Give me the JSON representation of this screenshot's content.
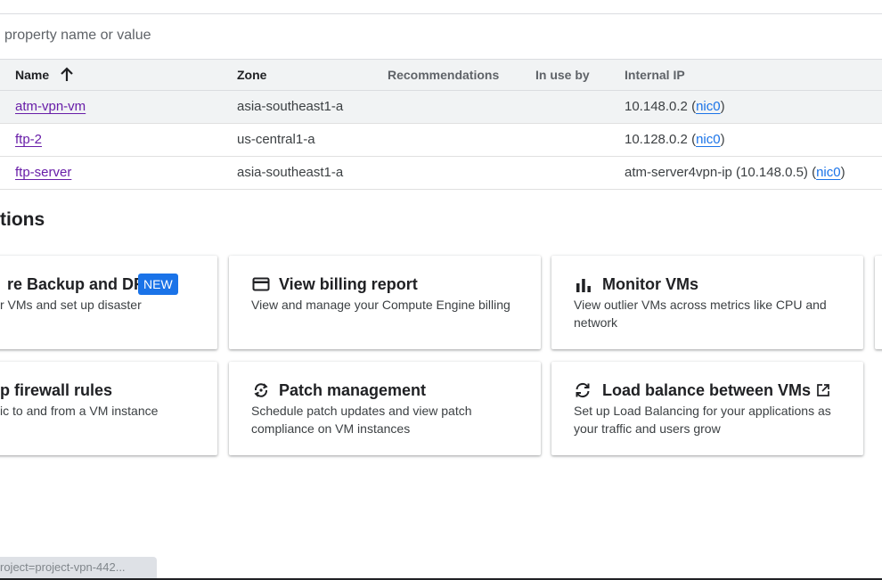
{
  "filter": {
    "placeholder_fragment": "property name or value"
  },
  "table": {
    "columns": {
      "name": "Name",
      "zone": "Zone",
      "recommendations": "Recommendations",
      "in_use_by": "In use by",
      "internal_ip": "Internal IP"
    },
    "rows": [
      {
        "name": "atm-vpn-vm",
        "zone": "asia-southeast1-a",
        "ip_prefix": "10.148.0.2 (",
        "nic": "nic0",
        "ip_suffix": ")"
      },
      {
        "name": "ftp-2",
        "zone": "us-central1-a",
        "ip_prefix": "10.128.0.2 (",
        "nic": "nic0",
        "ip_suffix": ")"
      },
      {
        "name": "ftp-server",
        "zone": "asia-southeast1-a",
        "ip_prefix": "atm-server4vpn-ip (10.148.0.5) (",
        "nic": "nic0",
        "ip_suffix": ")"
      }
    ]
  },
  "section": {
    "title": "tions"
  },
  "cards": [
    {
      "title": "re Backup and DR",
      "badge": "NEW",
      "desc": "r VMs and set up disaster"
    },
    {
      "title": "View billing report",
      "icon": "credit-card-icon",
      "desc": "View and manage your Compute Engine billing"
    },
    {
      "title": "Monitor VMs",
      "icon": "bar-chart-icon",
      "desc": "View outlier VMs across metrics like CPU and network"
    },
    {
      "title": "p firewall rules",
      "desc": "ic to and from a VM instance"
    },
    {
      "title": "Patch management",
      "icon": "patch-sync-icon",
      "desc": "Schedule patch updates and view patch compliance on VM instances"
    },
    {
      "title": "Load balance between VMs",
      "icon": "refresh-icon",
      "trailing_icon": "open-in-new-icon",
      "desc": "Set up Load Balancing for your applications as your traffic and users grow"
    }
  ],
  "statusbar": {
    "url": "roject=project-vpn-442..."
  }
}
